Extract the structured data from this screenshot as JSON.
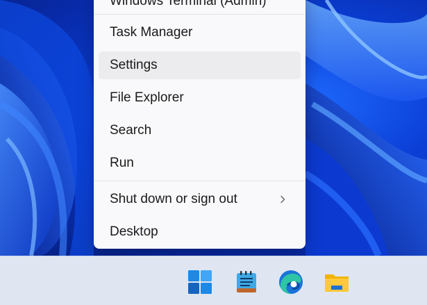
{
  "menu": {
    "items": [
      {
        "label": "Windows Terminal (Admin)",
        "selected": false
      },
      {
        "label": "Task Manager",
        "selected": false
      },
      {
        "label": "Settings",
        "selected": true
      },
      {
        "label": "File Explorer",
        "selected": false
      },
      {
        "label": "Search",
        "selected": false
      },
      {
        "label": "Run",
        "selected": false
      },
      {
        "label": "Shut down or sign out",
        "selected": false,
        "has_submenu": true
      },
      {
        "label": "Desktop",
        "selected": false
      }
    ]
  },
  "taskbar": {
    "icons": [
      "windows-start-icon",
      "notepad-icon",
      "edge-icon",
      "file-explorer-icon"
    ]
  },
  "colors": {
    "wallpaper_blue": "#0b3fd6",
    "menu_background": "#f9f9fb",
    "selected_background": "#ececee",
    "taskbar_background": "#dfe6f1"
  }
}
